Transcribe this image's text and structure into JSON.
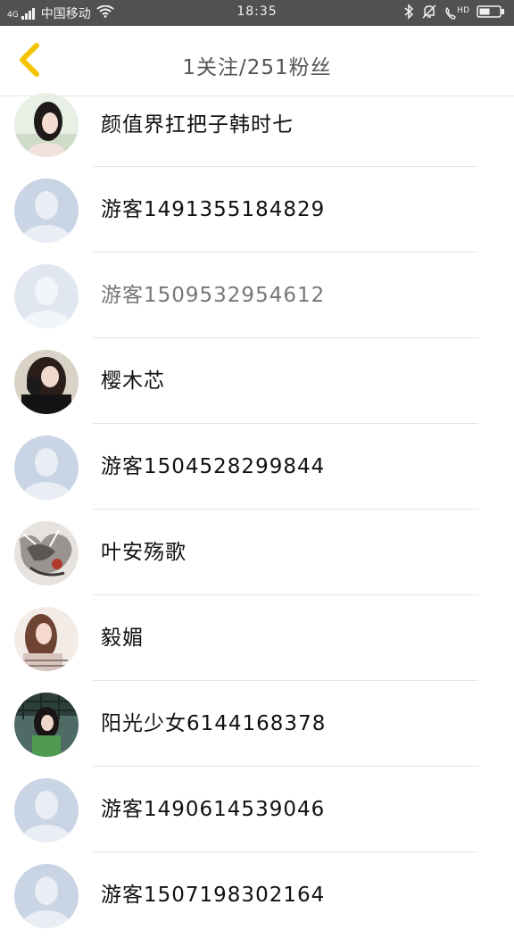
{
  "status_bar": {
    "signal_label": "4G",
    "carrier": "中国移动",
    "time": "18:35",
    "hd_label": "HD"
  },
  "header": {
    "title": "1关注/251粉丝"
  },
  "users": [
    {
      "name": "颜值界扛把子韩时七",
      "avatar": "photo-girl-light"
    },
    {
      "name": "游客1491355184829",
      "avatar": "default"
    },
    {
      "name": "游客1509532954612",
      "avatar": "default"
    },
    {
      "name": "樱木芯",
      "avatar": "photo-girl-dark"
    },
    {
      "name": "游客1504528299844",
      "avatar": "default"
    },
    {
      "name": "叶安殇歌",
      "avatar": "photo-anime"
    },
    {
      "name": "毅媚",
      "avatar": "photo-girl-warm"
    },
    {
      "name": "阳光少女6144168378",
      "avatar": "photo-girl-green"
    },
    {
      "name": "游客1490614539046",
      "avatar": "default"
    },
    {
      "name": "游客1507198302164",
      "avatar": "default"
    }
  ],
  "colors": {
    "status_bar_bg": "#515151",
    "accent": "#f5c400",
    "default_avatar_bg": "#c9d4e4",
    "default_avatar_fg": "#e9eef5"
  }
}
